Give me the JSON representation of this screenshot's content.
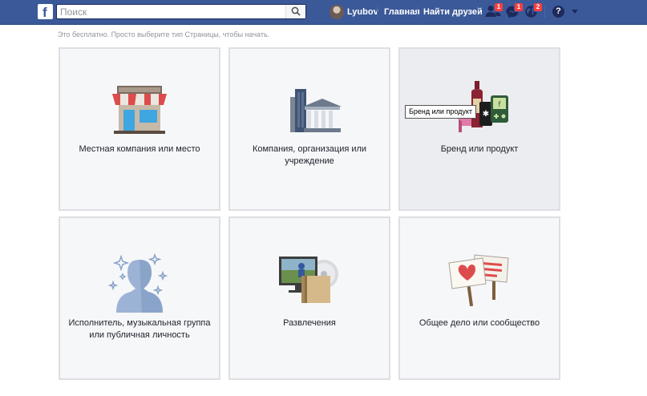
{
  "topbar": {
    "logo": "f",
    "search_placeholder": "Поиск",
    "user_name": "Lyubov",
    "home": "Главная",
    "find_friends": "Найти друзей",
    "friend_requests_count": "1",
    "messages_count": "1",
    "notifications_count": "2",
    "help": "?"
  },
  "intro": "Это бесплатно. Просто выберите тип Страницы, чтобы начать.",
  "cards": [
    {
      "label": "Местная компания или место",
      "icon": "storefront-icon"
    },
    {
      "label": "Компания, организация или учреждение",
      "icon": "buildings-icon"
    },
    {
      "label": "Бренд или продукт",
      "icon": "products-icon"
    },
    {
      "label": "Исполнитель, музыкальная группа или публичная личность",
      "icon": "person-silhouette-icon"
    },
    {
      "label": "Развлечения",
      "icon": "media-icon"
    },
    {
      "label": "Общее дело или сообщество",
      "icon": "signs-icon"
    }
  ],
  "tooltip": "Бренд или продукт",
  "colors": {
    "brand": "#3b5998",
    "badge": "#fa3e3e",
    "card_bg": "#f6f7f9",
    "card_border": "#dddfe2"
  }
}
